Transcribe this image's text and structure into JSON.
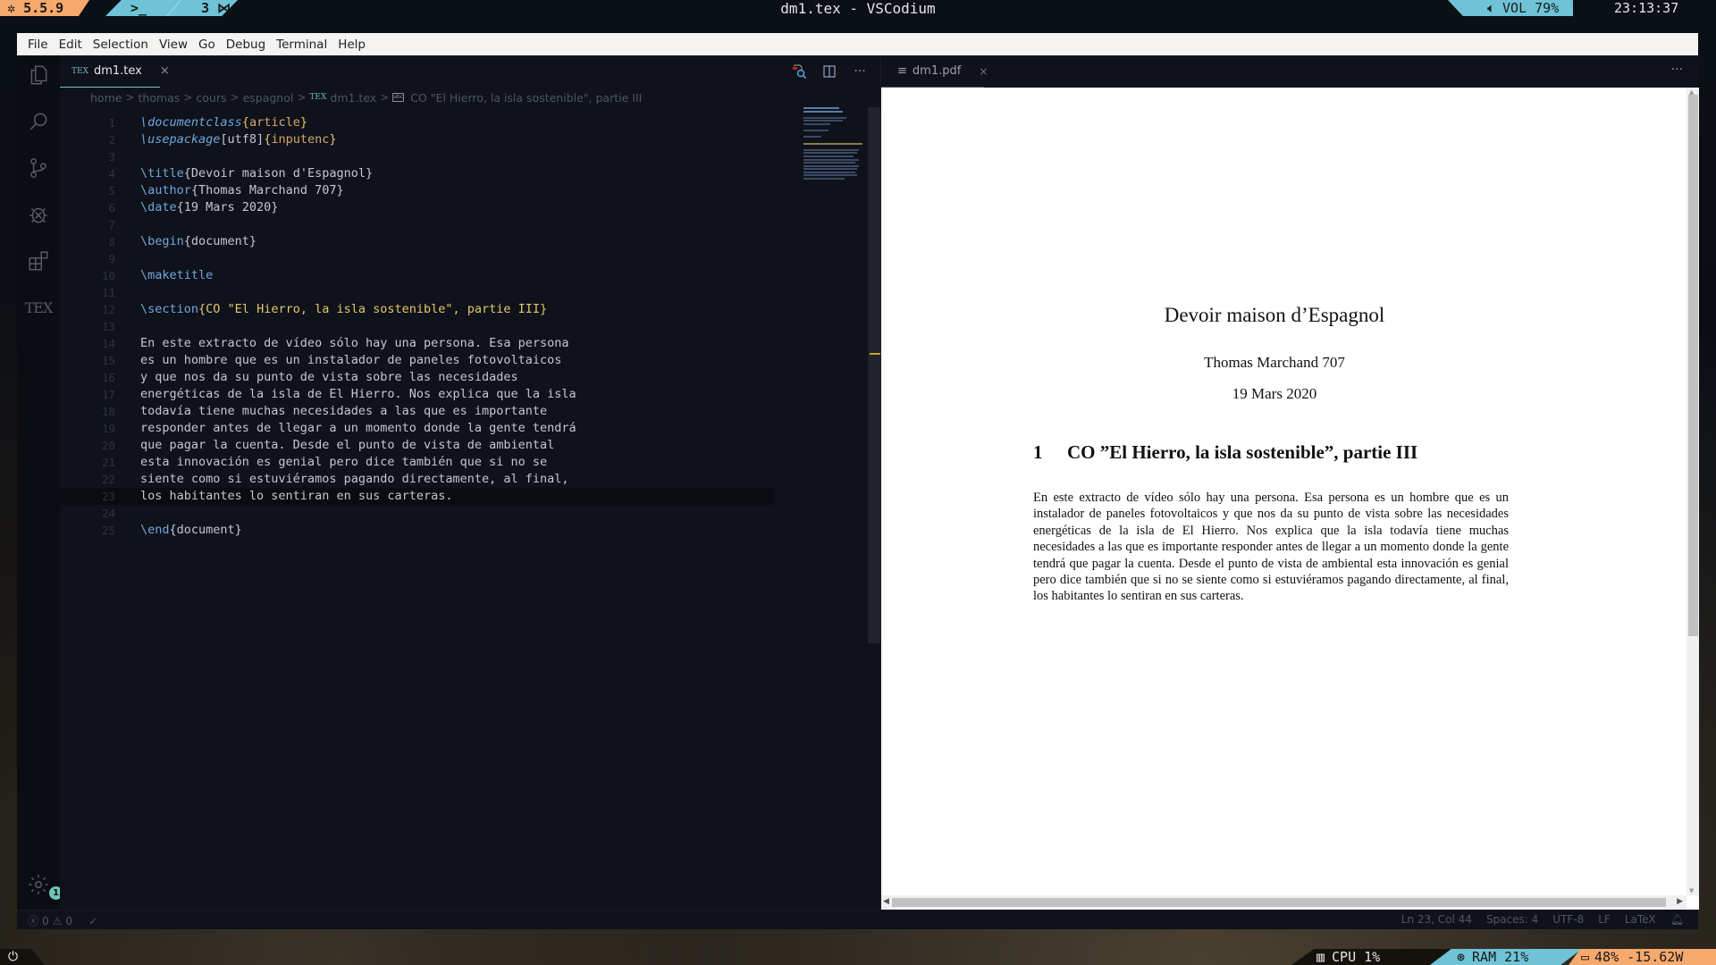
{
  "topbar": {
    "version": "5.5.9",
    "workspace_terminal": ">_",
    "workspace_number": "3",
    "window_title": "dm1.tex - VSCodium",
    "volume_label": "VOL 79%",
    "volume_percent": 79,
    "clock": "23:13:37"
  },
  "menu": [
    "File",
    "Edit",
    "Selection",
    "View",
    "Go",
    "Debug",
    "Terminal",
    "Help"
  ],
  "activity_bar": {
    "items": [
      "explorer-icon",
      "search-icon",
      "source-control-icon",
      "debug-icon",
      "extensions-icon",
      "tex-icon"
    ],
    "tex_label": "TEX",
    "settings_badge": "1"
  },
  "editor": {
    "tab": {
      "label": "dm1.tex",
      "icon": "TEX",
      "close": "×"
    },
    "actions": [
      "pdf-preview-icon",
      "split-editor-icon",
      "more-actions-icon"
    ],
    "more_label": "···",
    "breadcrumb": [
      "home",
      "thomas",
      "cours",
      "espagnol",
      "dm1.tex",
      "CO \"El Hierro, la isla sostenible\", partie III"
    ],
    "breadcrumb_sep": ">",
    "lines": [
      {
        "n": "1",
        "parts": [
          [
            "cmd-it",
            "\\documentclass"
          ],
          [
            "brace",
            "{"
          ],
          [
            "arg",
            "article"
          ],
          [
            "brace",
            "}"
          ]
        ]
      },
      {
        "n": "2",
        "parts": [
          [
            "cmd-it",
            "\\usepackage"
          ],
          [
            "argp",
            "[utf8]"
          ],
          [
            "brace",
            "{"
          ],
          [
            "arg",
            "inputenc"
          ],
          [
            "brace",
            "}"
          ]
        ]
      },
      {
        "n": "3",
        "parts": []
      },
      {
        "n": "4",
        "parts": [
          [
            "cmd",
            "\\title"
          ],
          [
            "argp",
            "{Devoir maison d'Espagnol}"
          ]
        ]
      },
      {
        "n": "5",
        "parts": [
          [
            "cmd",
            "\\author"
          ],
          [
            "argp",
            "{Thomas Marchand 707}"
          ]
        ]
      },
      {
        "n": "6",
        "parts": [
          [
            "cmd",
            "\\date"
          ],
          [
            "argp",
            "{19 Mars 2020}"
          ]
        ]
      },
      {
        "n": "7",
        "parts": []
      },
      {
        "n": "8",
        "parts": [
          [
            "cmd",
            "\\begin"
          ],
          [
            "argp",
            "{document}"
          ]
        ]
      },
      {
        "n": "9",
        "parts": []
      },
      {
        "n": "10",
        "parts": [
          [
            "cmd",
            "\\maketitle"
          ]
        ]
      },
      {
        "n": "11",
        "parts": []
      },
      {
        "n": "12",
        "parts": [
          [
            "cmd",
            "\\section"
          ],
          [
            "brace",
            "{"
          ],
          [
            "arg-sec",
            "CO \"El Hierro, la isla sostenible\", partie III"
          ],
          [
            "brace",
            "}"
          ]
        ]
      },
      {
        "n": "13",
        "parts": []
      },
      {
        "n": "14",
        "parts": [
          [
            "argp",
            "En este extracto de vídeo sólo hay una persona. Esa persona"
          ]
        ]
      },
      {
        "n": "15",
        "parts": [
          [
            "argp",
            "es un hombre que es un instalador de paneles fotovoltaicos"
          ]
        ]
      },
      {
        "n": "16",
        "parts": [
          [
            "argp",
            "y que nos da su punto de vista sobre las necesidades"
          ]
        ]
      },
      {
        "n": "17",
        "parts": [
          [
            "argp",
            "energéticas de la isla de El Hierro. Nos explica que la isla"
          ]
        ]
      },
      {
        "n": "18",
        "parts": [
          [
            "argp",
            "todavía tiene muchas necesidades a las que es importante"
          ]
        ]
      },
      {
        "n": "19",
        "parts": [
          [
            "argp",
            "responder antes de llegar a un momento donde la gente tendrá"
          ]
        ]
      },
      {
        "n": "20",
        "parts": [
          [
            "argp",
            "que pagar la cuenta. Desde el punto de vista de ambiental"
          ]
        ]
      },
      {
        "n": "21",
        "parts": [
          [
            "argp",
            "esta innovación es genial pero dice también que si no se"
          ]
        ]
      },
      {
        "n": "22",
        "parts": [
          [
            "argp",
            "siente como si estuviéramos pagando directamente, al final,"
          ]
        ]
      },
      {
        "n": "23",
        "parts": [
          [
            "argp",
            "los habitantes lo sentiran en sus carteras."
          ]
        ],
        "current": true
      },
      {
        "n": "24",
        "parts": []
      },
      {
        "n": "25",
        "parts": [
          [
            "cmd",
            "\\end"
          ],
          [
            "argp",
            "{document}"
          ]
        ]
      }
    ]
  },
  "pdf": {
    "tab": {
      "label": "dm1.pdf",
      "close": "×"
    },
    "more_label": "···",
    "title": "Devoir maison d’Espagnol",
    "author": "Thomas Marchand 707",
    "date": "19 Mars 2020",
    "section_number": "1",
    "section_title": "CO ”El Hierro, la isla sostenible”, partie III",
    "body": "En este extracto de vídeo sólo hay una persona. Esa persona es un hombre que es un instalador de paneles fotovoltaicos y que nos da su punto de vista sobre las necesidades energéticas de la isla de El Hierro. Nos explica que la isla todavía tiene muchas necesidades a las que es importante responder antes de llegar a un momento donde la gente tendrá que pagar la cuenta. Desde el punto de vista de ambiental esta innovación es genial pero dice también que si no se siente como si estuviéramos pagando directamente, al final, los habitantes lo sentiran en sus carteras."
  },
  "statusbar": {
    "errors": "0",
    "warnings": "0",
    "position": "Ln 23, Col 44",
    "spaces": "Spaces: 4",
    "encoding": "UTF-8",
    "eol": "LF",
    "language": "LaTeX"
  },
  "bottombar": {
    "cpu_label": "CPU 1%",
    "cpu_percent": 1,
    "ram_label": "RAM 21%",
    "ram_percent": 21,
    "battery_label": "48% -15.62W",
    "battery_percent": 48
  },
  "colors": {
    "accent_teal": "#6ec5b8",
    "bar_orange": "#f6a96c",
    "bar_blue": "#6fc3d6",
    "editor_bg": "#0f121a"
  }
}
